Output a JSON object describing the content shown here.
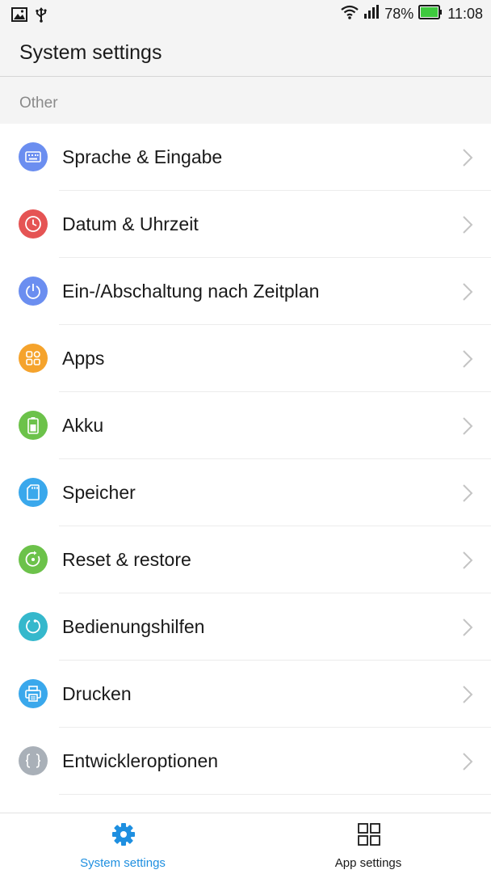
{
  "status_bar": {
    "battery_percent": "78%",
    "time": "11:08",
    "icons": [
      "image-icon",
      "usb-icon",
      "wifi-icon",
      "signal-icon",
      "battery-icon"
    ],
    "battery_color": "#3ec93e"
  },
  "header": {
    "title": "System settings"
  },
  "section": {
    "label": "Other"
  },
  "items": [
    {
      "label": "Sprache & Eingabe",
      "icon": "keyboard-icon",
      "color": "#6b8ef0"
    },
    {
      "label": "Datum & Uhrzeit",
      "icon": "clock-icon",
      "color": "#e55454"
    },
    {
      "label": "Ein-/Abschaltung nach Zeitplan",
      "icon": "power-icon",
      "color": "#6b8ef0"
    },
    {
      "label": "Apps",
      "icon": "apps-grid-icon",
      "color": "#f5a32c"
    },
    {
      "label": "Akku",
      "icon": "battery-icon",
      "color": "#6cc24a"
    },
    {
      "label": "Speicher",
      "icon": "sd-card-icon",
      "color": "#3aa8ec"
    },
    {
      "label": "Reset & restore",
      "icon": "restore-icon",
      "color": "#6cc24a"
    },
    {
      "label": "Bedienungshilfen",
      "icon": "accessibility-icon",
      "color": "#35b8cc"
    },
    {
      "label": "Drucken",
      "icon": "printer-icon",
      "color": "#3aa8ec"
    },
    {
      "label": "Entwickleroptionen",
      "icon": "braces-icon",
      "color": "#a9b0b8"
    }
  ],
  "bottom_nav": {
    "system_settings_label": "System settings",
    "app_settings_label": "App settings",
    "active_color": "#1e8fe0",
    "inactive_color": "#1a1a1a"
  }
}
